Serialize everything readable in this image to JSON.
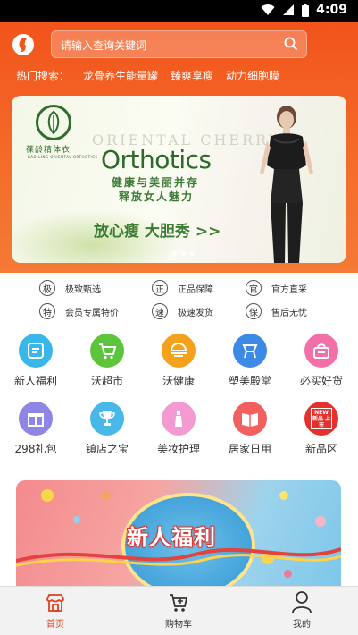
{
  "status_bar": {
    "time": "4:09"
  },
  "header": {
    "search_placeholder": "请输入查询关键词",
    "hot_label": "热门搜索：",
    "hot_terms": [
      "龙骨养生能量罐",
      "臻爽享瘦",
      "动力细胞膜"
    ]
  },
  "banner": {
    "brand_name": "葆龄精体衣",
    "brand_sub": "BAO-LING ORIENTAL ORTHOTICS",
    "watermark": "ORIENTAL CHERRY",
    "title": "Orthotics",
    "tagline_1": "健康与美丽并存",
    "tagline_2": "释放女人魅力",
    "cta": "放心瘦 大胆秀 >>"
  },
  "guarantees": [
    {
      "badge": "极",
      "text": "极致甄选"
    },
    {
      "badge": "正",
      "text": "正品保障"
    },
    {
      "badge": "官",
      "text": "官方直采"
    },
    {
      "badge": "特",
      "text": "会员专属特价"
    },
    {
      "badge": "速",
      "text": "极速发货"
    },
    {
      "badge": "保",
      "text": "售后无忧"
    }
  ],
  "categories": [
    {
      "label": "新人福利",
      "icon": "gift-note-icon",
      "color": "#39b7e8"
    },
    {
      "label": "沃超市",
      "icon": "cart-icon",
      "color": "#5cc53c"
    },
    {
      "label": "沃健康",
      "icon": "health-bowl-icon",
      "color": "#f5a11b"
    },
    {
      "label": "塑美殿堂",
      "icon": "chair-icon",
      "color": "#3d8ae6"
    },
    {
      "label": "必买好货",
      "icon": "basket-icon",
      "color": "#f26fa9"
    },
    {
      "label": "298礼包",
      "icon": "gift-box-icon",
      "color": "#8f85e6"
    },
    {
      "label": "镇店之宝",
      "icon": "trophy-icon",
      "color": "#48b8e8"
    },
    {
      "label": "美妆护理",
      "icon": "cosmetic-bottle-icon",
      "color": "#f39ad3"
    },
    {
      "label": "居家日用",
      "icon": "book-icon",
      "color": "#f25f5f"
    },
    {
      "label": "新品区",
      "icon": "new-arrival-icon",
      "color": "#e3312d",
      "badge_text": "NEW 新品 上市"
    }
  ],
  "promo": {
    "title": "新人福利"
  },
  "tabbar": {
    "items": [
      {
        "label": "首页",
        "icon": "shop-icon",
        "active": true
      },
      {
        "label": "购物车",
        "icon": "cart-icon",
        "active": false
      },
      {
        "label": "我的",
        "icon": "user-icon",
        "active": false
      }
    ],
    "active_color": "#e0401e",
    "inactive_color": "#333333"
  }
}
